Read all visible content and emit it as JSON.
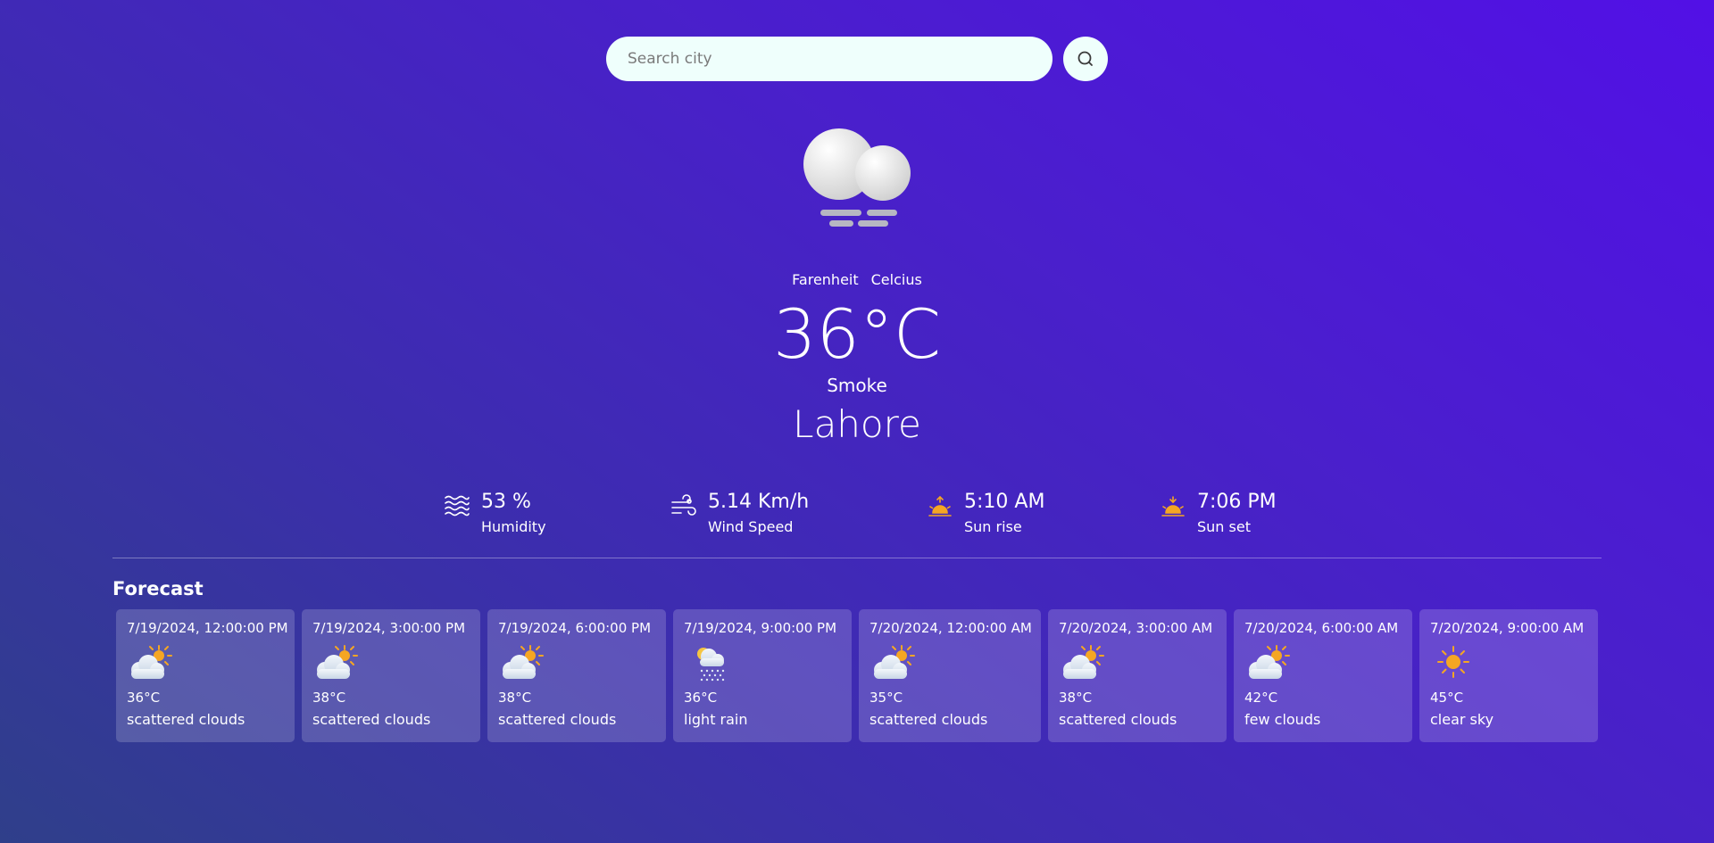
{
  "search": {
    "placeholder": "Search city"
  },
  "units": {
    "fahrenheit": "Farenheit",
    "celsius": "Celcius"
  },
  "current": {
    "temperature": "36°C",
    "description": "Smoke",
    "city": "Lahore",
    "icon": "fog-icon"
  },
  "stats": {
    "humidity": {
      "value": "53 %",
      "label": "Humidity",
      "icon": "humidity-waves-icon"
    },
    "wind": {
      "value": "5.14 Km/h",
      "label": "Wind Speed",
      "icon": "wind-icon"
    },
    "sunrise": {
      "value": "5:10 AM",
      "label": "Sun rise",
      "icon": "sunrise-icon"
    },
    "sunset": {
      "value": "7:06 PM",
      "label": "Sun set",
      "icon": "sunset-icon"
    }
  },
  "forecast": {
    "title": "Forecast",
    "items": [
      {
        "date": "7/19/2024, 12:00:00 PM",
        "temp": "36°C",
        "desc": "scattered clouds",
        "icon": "partly-cloudy-icon"
      },
      {
        "date": "7/19/2024, 3:00:00 PM",
        "temp": "38°C",
        "desc": "scattered clouds",
        "icon": "partly-cloudy-icon"
      },
      {
        "date": "7/19/2024, 6:00:00 PM",
        "temp": "38°C",
        "desc": "scattered clouds",
        "icon": "partly-cloudy-icon"
      },
      {
        "date": "7/19/2024, 9:00:00 PM",
        "temp": "36°C",
        "desc": "light rain",
        "icon": "rain-icon"
      },
      {
        "date": "7/20/2024, 12:00:00 AM",
        "temp": "35°C",
        "desc": "scattered clouds",
        "icon": "partly-cloudy-icon"
      },
      {
        "date": "7/20/2024, 3:00:00 AM",
        "temp": "38°C",
        "desc": "scattered clouds",
        "icon": "partly-cloudy-icon"
      },
      {
        "date": "7/20/2024, 6:00:00 AM",
        "temp": "42°C",
        "desc": "few clouds",
        "icon": "partly-cloudy-icon"
      },
      {
        "date": "7/20/2024, 9:00:00 AM",
        "temp": "45°C",
        "desc": "clear sky",
        "icon": "sun-icon"
      }
    ]
  },
  "colors": {
    "accent_sun": "#f5a623",
    "search_bg": "#effffc"
  }
}
